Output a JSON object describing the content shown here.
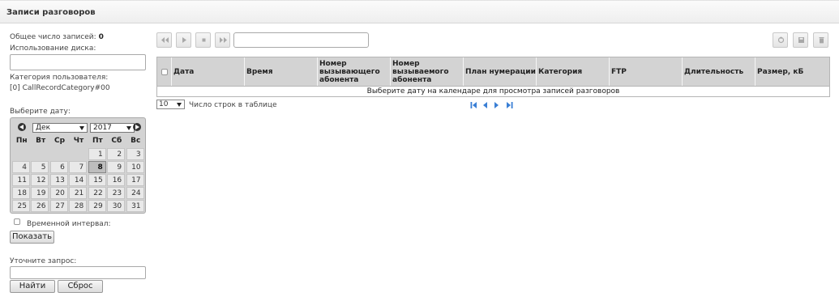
{
  "window": {
    "title": "Записи разговоров"
  },
  "left": {
    "total_label": "Общее число записей:",
    "total_value": "0",
    "disk_label": "Использование диска:",
    "disk_value": "",
    "category_label": "Категория пользователя:",
    "category_value": "[0] CallRecordCategory#00",
    "date_label": "Выберите дату:",
    "interval_label": "Временной интервал:",
    "show_button": "Показать",
    "refine_label": "Уточните запрос:",
    "refine_value": "",
    "find_button": "Найти",
    "reset_button": "Сброс"
  },
  "calendar": {
    "month": "Дек",
    "year": "2017",
    "weekdays": [
      "Пн",
      "Вт",
      "Ср",
      "Чт",
      "Пт",
      "Сб",
      "Вс"
    ],
    "today": "8",
    "weeks": [
      [
        "",
        "",
        "",
        "",
        "1",
        "2",
        "3"
      ],
      [
        "4",
        "5",
        "6",
        "7",
        "8",
        "9",
        "10"
      ],
      [
        "11",
        "12",
        "13",
        "14",
        "15",
        "16",
        "17"
      ],
      [
        "18",
        "19",
        "20",
        "21",
        "22",
        "23",
        "24"
      ],
      [
        "25",
        "26",
        "27",
        "28",
        "29",
        "30",
        "31"
      ]
    ]
  },
  "player": {
    "buttons": [
      "rewind",
      "play",
      "stop",
      "fast-forward"
    ],
    "track_value": ""
  },
  "toolbar_right": [
    "refresh-icon",
    "save-icon",
    "delete-icon"
  ],
  "table": {
    "columns": [
      "Дата",
      "Время",
      "Номер вызывающего абонента",
      "Номер вызываемого абонента",
      "План нумерации",
      "Категория",
      "FTP",
      "Длительность",
      "Размер, кБ"
    ],
    "empty_message": "Выберите дату на календаре для просмотра записей разговоров"
  },
  "pager": {
    "rows_value": "10",
    "rows_label": "Число строк в таблице",
    "accent": "#3a7fd5"
  }
}
